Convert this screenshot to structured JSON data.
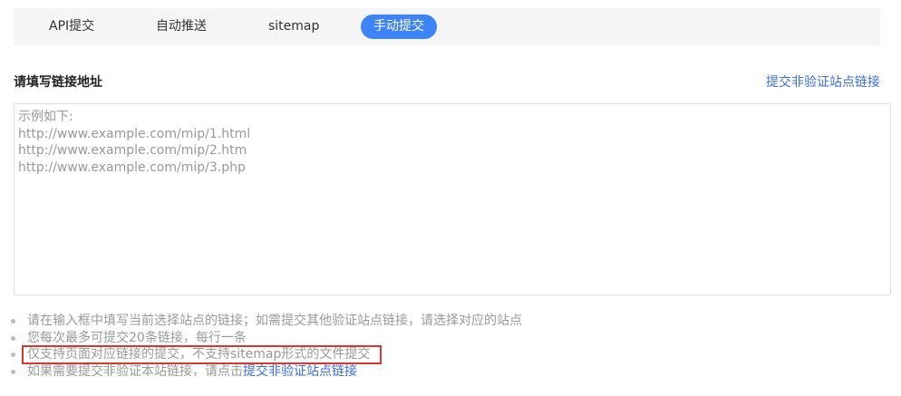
{
  "tabs": [
    {
      "label": "API提交",
      "active": false
    },
    {
      "label": "自动推送",
      "active": false
    },
    {
      "label": "sitemap",
      "active": false
    },
    {
      "label": "手动提交",
      "active": true
    }
  ],
  "form": {
    "title": "请填写链接地址",
    "top_link": "提交非验证站点链接",
    "placeholder_lines": [
      "示例如下:",
      "http://www.example.com/mip/1.html",
      "http://www.example.com/mip/2.htm",
      "http://www.example.com/mip/3.php"
    ]
  },
  "tips": [
    "请在输入框中填写当前选择站点的链接；如需提交其他验证站点链接，请选择对应的站点",
    "您每次最多可提交20条链接，每行一条",
    "仅支持页面对应链接的提交，不支持sitemap形式的文件提交",
    "如果需要提交非验证本站链接，请点击"
  ],
  "tip_link": "提交非验证站点链接",
  "colors": {
    "accent": "#3c84f8",
    "link": "#3c6de0",
    "highlight_border": "#e0342e"
  }
}
